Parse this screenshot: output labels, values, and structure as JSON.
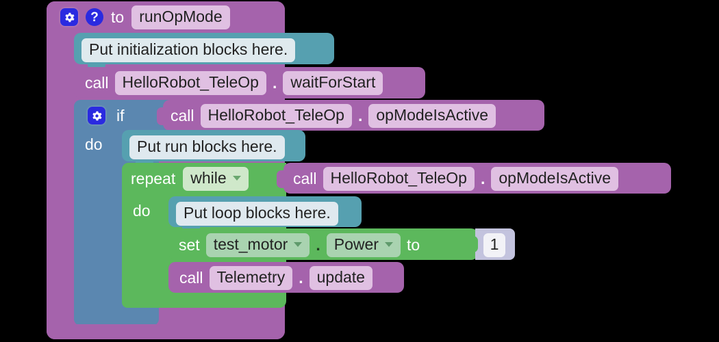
{
  "editor": {
    "name": "blockly-workspace",
    "background": "#000000"
  },
  "colors": {
    "procedure_purple": "#a563ac",
    "procedure_field": "#e0c0e2",
    "comment_teal": "#56a0b0",
    "control_blue": "#5b87b0",
    "loop_green": "#5cb85c",
    "number_lavender": "#c3c3de",
    "icon_blue": "#2a2ae0"
  },
  "blocks": {
    "procedure_def": {
      "mutator_icon": "gear-icon",
      "help_icon": "question-mark-icon",
      "keyword": "to",
      "name_field": "runOpMode"
    },
    "init_comment": {
      "text": "Put initialization blocks here."
    },
    "call_wait_for_start": {
      "keyword": "call",
      "object_field": "HelloRobot_TeleOp",
      "separator": ".",
      "method_field": "waitForStart"
    },
    "if_block": {
      "mutator_icon": "gear-icon",
      "keyword": "if",
      "do_label": "do",
      "condition": {
        "keyword": "call",
        "object_field": "HelloRobot_TeleOp",
        "separator": ".",
        "method_field": "opModeIsActive"
      }
    },
    "run_comment": {
      "text": "Put run blocks here."
    },
    "repeat_block": {
      "keyword": "repeat",
      "mode_field": "while",
      "mode_dropdown_icon": "chevron-down-icon",
      "do_label": "do",
      "condition": {
        "keyword": "call",
        "object_field": "HelloRobot_TeleOp",
        "separator": ".",
        "method_field": "opModeIsActive"
      }
    },
    "loop_comment": {
      "text": "Put loop blocks here."
    },
    "set_property": {
      "keyword": "set",
      "device_field": "test_motor",
      "device_dropdown_icon": "chevron-down-icon",
      "separator": ".",
      "property_field": "Power",
      "property_dropdown_icon": "chevron-down-icon",
      "to_label": "to",
      "value": "1"
    },
    "telemetry_update": {
      "keyword": "call",
      "object_field": "Telemetry",
      "separator": ".",
      "method_field": "update"
    }
  }
}
